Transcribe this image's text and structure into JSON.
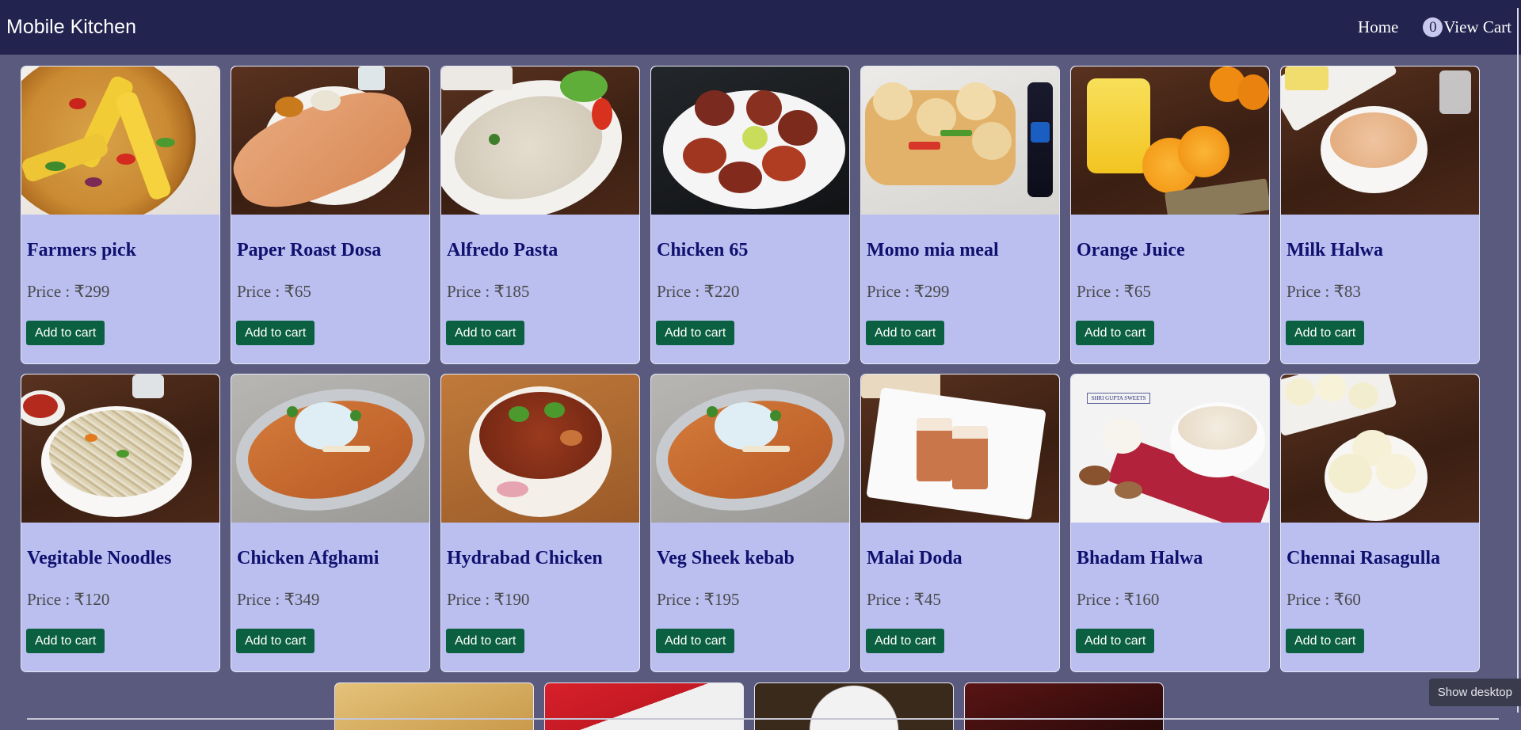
{
  "brand": "Mobile Kitchen",
  "nav": {
    "home": "Home",
    "cart_count": "0",
    "view_cart": "View Cart"
  },
  "add_label": "Add to cart",
  "products": [
    {
      "name": "Farmers pick",
      "price": "Price : ₹299",
      "image": "pizza"
    },
    {
      "name": "Paper Roast Dosa",
      "price": "Price : ₹65",
      "image": "dosa"
    },
    {
      "name": "Alfredo Pasta",
      "price": "Price : ₹185",
      "image": "pasta"
    },
    {
      "name": "Chicken 65",
      "price": "Price : ₹220",
      "image": "chicken-65"
    },
    {
      "name": "Momo mia meal",
      "price": "Price : ₹299",
      "image": "momo-pizza"
    },
    {
      "name": "Orange Juice",
      "price": "Price : ₹65",
      "image": "orange-juice"
    },
    {
      "name": "Milk Halwa",
      "price": "Price : ₹83",
      "image": "milk-halwa"
    },
    {
      "name": "Vegitable Noodles",
      "price": "Price : ₹120",
      "image": "noodles"
    },
    {
      "name": "Chicken Afghami",
      "price": "Price : ₹349",
      "image": "afghami"
    },
    {
      "name": "Hydrabad Chicken",
      "price": "Price : ₹190",
      "image": "curry"
    },
    {
      "name": "Veg Sheek kebab",
      "price": "Price : ₹195",
      "image": "kebab"
    },
    {
      "name": "Malai Doda",
      "price": "Price : ₹45",
      "image": "malai-doda"
    },
    {
      "name": "Bhadam Halwa",
      "price": "Price : ₹160",
      "image": "badam-halwa"
    },
    {
      "name": "Chennai Rasagulla",
      "price": "Price : ₹60",
      "image": "rasagulla"
    }
  ],
  "image_text": {
    "sweets_sign": "SHRI GUPTA SWEETS"
  },
  "show_desktop": "Show desktop"
}
